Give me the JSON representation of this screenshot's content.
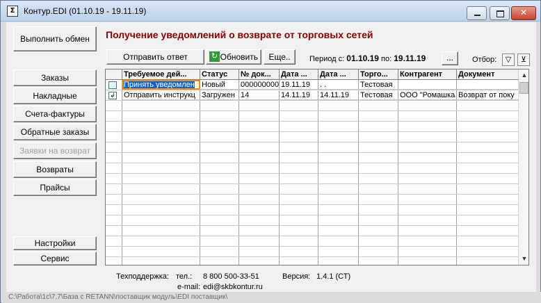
{
  "window": {
    "title": "Контур.EDI (01.10.19 - 19.11.19)"
  },
  "sidebar": {
    "exchange": "Выполнить обмен",
    "items": [
      {
        "label": "Заказы",
        "enabled": true
      },
      {
        "label": "Накладные",
        "enabled": true
      },
      {
        "label": "Счета-фактуры",
        "enabled": true
      },
      {
        "label": "Обратные заказы",
        "enabled": true
      },
      {
        "label": "Заявки на возврат",
        "enabled": false
      },
      {
        "label": "Возвраты",
        "enabled": true
      },
      {
        "label": "Прайсы",
        "enabled": true
      }
    ],
    "settings": "Настройки",
    "service": "Сервис"
  },
  "main": {
    "heading": "Получение уведомлений о возврате от торговых сетей",
    "toolbar": {
      "send_reply": "Отправить ответ",
      "refresh": "Обновить",
      "more": "Еще..",
      "period_from_label": "Период с:",
      "period_from": "01.10.19",
      "period_to_label": "по:",
      "period_to": "19.11.19",
      "period_button": "...",
      "filter_label": "Отбор:"
    },
    "table": {
      "columns": [
        "Требуемое дей...",
        "Статус",
        "№ док...",
        "Дата ...",
        "Дата ...",
        "Торго...",
        "Контрагент",
        "Документ"
      ],
      "rows": [
        {
          "icon": "document-icon",
          "cells": [
            "Принять уведомлен",
            "Новый",
            "000000000",
            "19.11.19",
            " .  .",
            "Тестовая",
            "",
            ""
          ]
        },
        {
          "icon": "reply-icon",
          "cells": [
            "Отправить инструкц",
            "Загружен",
            "14",
            "14.11.19",
            "14.11.19",
            "Тестовая",
            "ООО \"Ромашка",
            "Возврат от поку"
          ]
        }
      ]
    }
  },
  "footer": {
    "support_label": "Техподдержка:",
    "phone_label": "тел.:",
    "phone": "8 800 500-33-51",
    "email_label": "e-mail:",
    "email": "edi@skbkontur.ru",
    "version_label": "Версия:",
    "version": "1.4.1 (СТ)"
  },
  "status_bar": "C:\\Работа\\1с\\7.7\\База с RETANN\\поставщик модуль\\EDI поставщик\\",
  "colors": {
    "heading": "#8b0000",
    "selection": "#0a64d6",
    "focus_outline": "#ff8c00"
  }
}
